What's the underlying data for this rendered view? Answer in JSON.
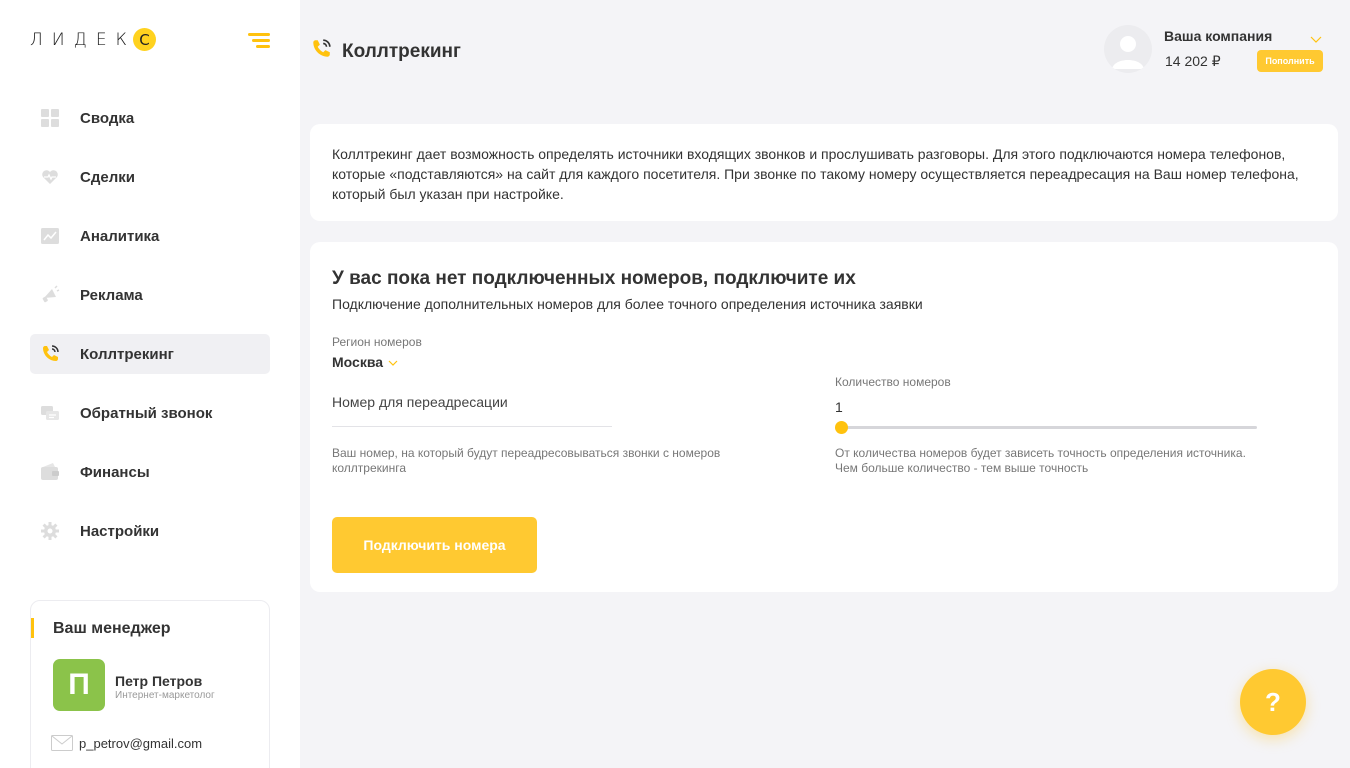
{
  "brand": {
    "logo_text": "ЛИДЕК",
    "logo_letter": "С",
    "accent": "#ffc20e"
  },
  "sidebar": {
    "items": [
      {
        "label": "Сводка",
        "icon": "dashboard-icon",
        "active": false
      },
      {
        "label": "Сделки",
        "icon": "heart-pulse-icon",
        "active": false
      },
      {
        "label": "Аналитика",
        "icon": "chart-icon",
        "active": false
      },
      {
        "label": "Реклама",
        "icon": "megaphone-icon",
        "active": false
      },
      {
        "label": "Коллтрекинг",
        "icon": "phone-icon",
        "active": true
      },
      {
        "label": "Обратный звонок",
        "icon": "chat-icon",
        "active": false
      },
      {
        "label": "Финансы",
        "icon": "wallet-icon",
        "active": false
      },
      {
        "label": "Настройки",
        "icon": "gear-icon",
        "active": false
      }
    ],
    "manager": {
      "title": "Ваш менеджер",
      "initial": "П",
      "name": "Петр Петров",
      "role": "Интернет-маркетолог",
      "email": "p_petrov@gmail.com"
    }
  },
  "header": {
    "title": "Коллтрекинг",
    "company": "Ваша компания",
    "balance": "14 202 ₽",
    "topup_label": "Пополнить"
  },
  "info": {
    "text": "Коллтрекинг дает возможность определять источники входящих звонков и прослушивать разговоры. Для этого подключаются номера телефонов, которые «подставляются» на сайт для каждого посетителя. При звонке по такому номеру осуществляется переадресация на Ваш номер телефона, который был указан при настройке."
  },
  "main": {
    "heading": "У вас пока нет подключенных номеров, подключите их",
    "subheading": "Подключение дополнительных номеров для более точного определения источника заявки",
    "region_label": "Регион номеров",
    "region_value": "Москва",
    "redirect_label": "Номер для переадресации",
    "redirect_value": "",
    "redirect_hint": "Ваш номер, на который будут переадресовываться звонки с номеров коллтрекинга",
    "count_label": "Количество номеров",
    "count_value": "1",
    "count_hint": "От количества номеров будет зависеть точность определения источника. Чем больше количество - тем выше точность",
    "connect_label": "Подключить номера"
  },
  "help": {
    "label": "?"
  }
}
